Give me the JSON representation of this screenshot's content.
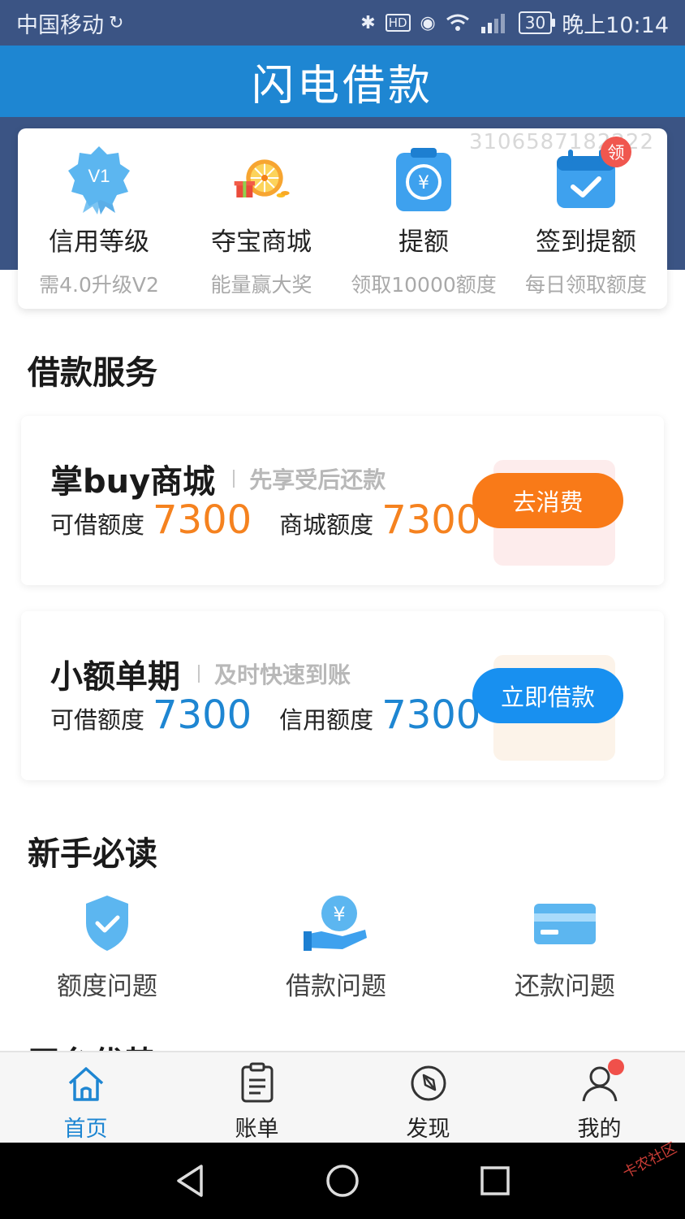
{
  "status_bar": {
    "carrier": "中国移动",
    "battery": "30",
    "time": "晚上10:14",
    "network": "4G"
  },
  "header": {
    "title": "闪电借款"
  },
  "feature_card": {
    "watermark": "3106587182222",
    "items": [
      {
        "title": "信用等级",
        "subtitle": "需4.0升级V2",
        "badge": "V1",
        "icon": "v1-badge-icon"
      },
      {
        "title": "夺宝商城",
        "subtitle": "能量赢大奖",
        "icon": "prize-wheel-icon"
      },
      {
        "title": "提额",
        "subtitle": "领取10000额度",
        "icon": "clipboard-yen-icon"
      },
      {
        "title": "签到提额",
        "subtitle": "每日领取额度",
        "badge": "领",
        "icon": "calendar-check-icon"
      }
    ]
  },
  "loan_section": {
    "title": "借款服务",
    "cards": [
      {
        "name": "掌buy商城",
        "tag": "先享受后还款",
        "label1": "可借额度",
        "value1": "7300",
        "label2": "商城额度",
        "value2": "7300",
        "button": "去消费",
        "accent": "#f5821f"
      },
      {
        "name": "小额单期",
        "tag": "及时快速到账",
        "label1": "可借额度",
        "value1": "7300",
        "label2": "信用额度",
        "value2": "7300",
        "button": "立即借款",
        "accent": "#1e86d2"
      }
    ]
  },
  "guide_section": {
    "title": "新手必读",
    "items": [
      {
        "label": "额度问题",
        "icon": "shield-check-icon"
      },
      {
        "label": "借款问题",
        "icon": "hand-coin-icon"
      },
      {
        "label": "还款问题",
        "icon": "credit-card-icon"
      }
    ]
  },
  "partial_section": {
    "title": "平台优势"
  },
  "tabbar": {
    "items": [
      {
        "label": "首页",
        "icon": "home-icon",
        "active": true
      },
      {
        "label": "账单",
        "icon": "bill-icon"
      },
      {
        "label": "发现",
        "icon": "compass-icon"
      },
      {
        "label": "我的",
        "icon": "user-icon",
        "dot": true
      }
    ]
  },
  "watermark_logo": "卡农社区"
}
